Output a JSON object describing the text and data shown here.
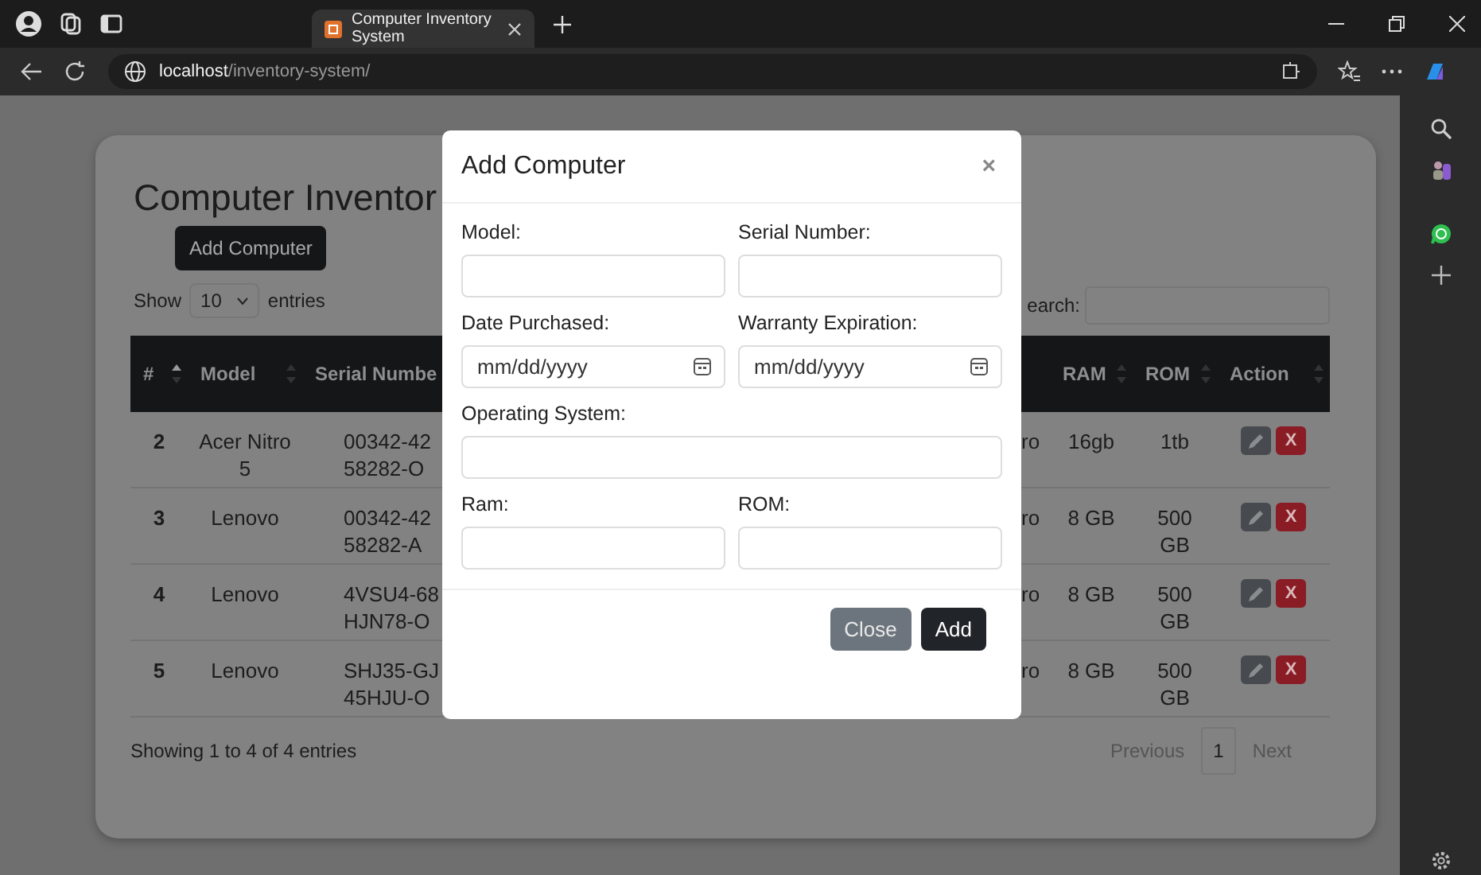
{
  "browser": {
    "tab_title": "Computer Inventory System",
    "url_host": "localhost",
    "url_path": "/inventory-system/"
  },
  "page": {
    "title": "Computer Inventor",
    "add_button": "Add Computer",
    "length": {
      "prefix": "Show",
      "value": "10",
      "suffix": "entries"
    },
    "search_label": "earch:",
    "columns": [
      {
        "label": "#",
        "sorted": true
      },
      {
        "label": "Model",
        "sorted": false
      },
      {
        "label": "Serial Numbe"
      },
      {
        "label": "RAM",
        "sorted": false
      },
      {
        "label": "ROM",
        "sorted": false
      },
      {
        "label": "Action",
        "sorted": false
      }
    ],
    "rows": [
      {
        "number": "2",
        "model": "Acer Nitro 5",
        "serial": "00342-42 58282-O",
        "os": "ro",
        "ram": "16gb",
        "rom": "1tb",
        "delete": "X"
      },
      {
        "number": "3",
        "model": "Lenovo",
        "serial": "00342-42 58282-A",
        "os": "ro",
        "ram": "8 GB",
        "rom": "500 GB",
        "delete": "X"
      },
      {
        "number": "4",
        "model": "Lenovo",
        "serial": "4VSU4-68 HJN78-O",
        "os": "ro",
        "ram": "8 GB",
        "rom": "500 GB",
        "delete": "X"
      },
      {
        "number": "5",
        "model": "Lenovo",
        "serial": "SHJ35-GJ 45HJU-O",
        "os": "ro",
        "ram": "8 GB",
        "rom": "500 GB",
        "delete": "X"
      }
    ],
    "info": "Showing 1 to 4 of 4 entries",
    "pagination": {
      "previous": {
        "label": "Previous",
        "disabled": true
      },
      "pages": [
        {
          "label": "1",
          "selected": true
        }
      ],
      "next": {
        "label": "Next",
        "disabled": true
      }
    }
  },
  "modal": {
    "title": "Add Computer",
    "close": "×",
    "rows": [
      {
        "fields": [
          {
            "kind": "text",
            "label": "Model:"
          },
          {
            "kind": "text",
            "label": "Serial Number:"
          }
        ]
      },
      {
        "fields": [
          {
            "kind": "date",
            "label": "Date Purchased:",
            "placeholder": "mm/dd/yyyy"
          },
          {
            "kind": "date",
            "label": "Warranty Expiration:",
            "placeholder": "mm/dd/yyyy"
          }
        ]
      },
      {
        "fields": [
          {
            "kind": "text",
            "label": "Operating System:"
          }
        ]
      },
      {
        "fields": [
          {
            "kind": "text",
            "label": "Ram:"
          },
          {
            "kind": "text",
            "label": "ROM:"
          }
        ]
      }
    ],
    "buttons": [
      {
        "kind": "secondary",
        "label": "Close"
      },
      {
        "kind": "primary",
        "label": "Add"
      }
    ]
  }
}
